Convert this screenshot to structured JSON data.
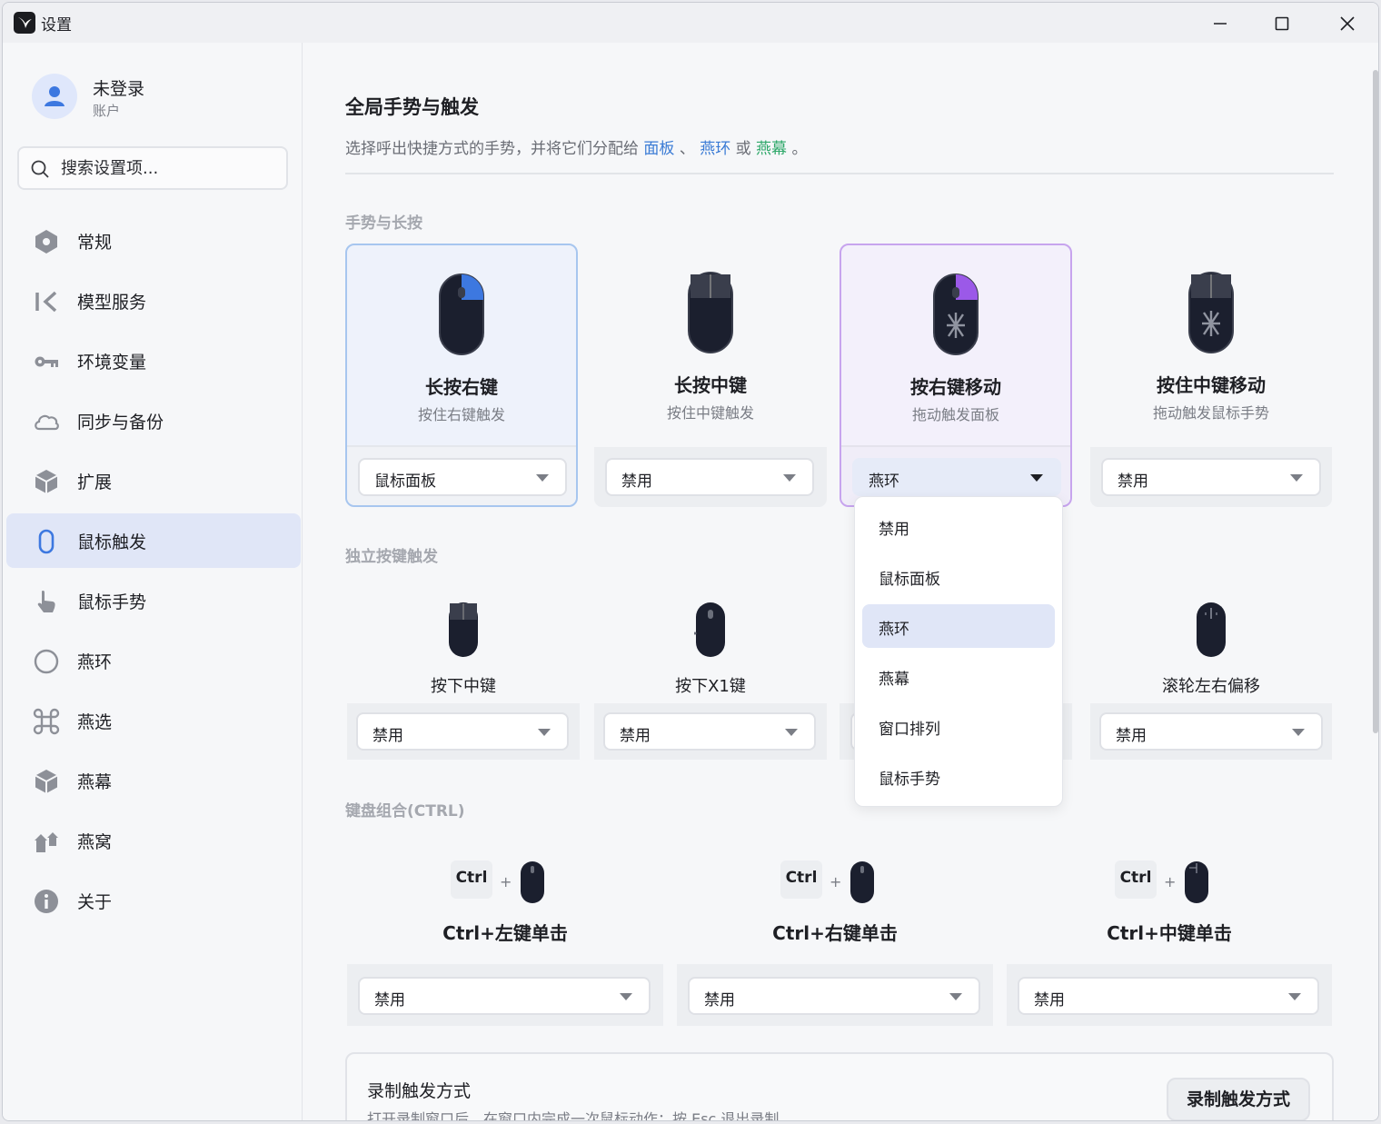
{
  "window": {
    "title": "设置"
  },
  "user": {
    "name": "未登录",
    "sub": "账户"
  },
  "search": {
    "placeholder": "搜索设置项..."
  },
  "nav": [
    {
      "label": "常规",
      "icon": "hexagon-icon"
    },
    {
      "label": "模型服务",
      "icon": "chevron-left-icon"
    },
    {
      "label": "环境变量",
      "icon": "key-icon"
    },
    {
      "label": "同步与备份",
      "icon": "cloud-icon"
    },
    {
      "label": "扩展",
      "icon": "cube-icon"
    },
    {
      "label": "鼠标触发",
      "icon": "mouse-icon"
    },
    {
      "label": "鼠标手势",
      "icon": "hand-pointer-icon"
    },
    {
      "label": "燕环",
      "icon": "circle-icon"
    },
    {
      "label": "燕选",
      "icon": "command-icon"
    },
    {
      "label": "燕幕",
      "icon": "cube-icon"
    },
    {
      "label": "燕窝",
      "icon": "houses-icon"
    },
    {
      "label": "关于",
      "icon": "info-icon"
    }
  ],
  "main": {
    "title": "全局手势与触发",
    "desc_prefix": "选择呼出快捷方式的手势，并将它们分配给",
    "link_panel": "面板",
    "sep1": "、",
    "link_ring": "燕环",
    "or": "或",
    "link_curtain": "燕幕",
    "period": "。"
  },
  "sections": {
    "gestures": "手势与长按",
    "buttons": "独立按键触发",
    "keyboard": "键盘组合(CTRL)"
  },
  "gesture_cards": [
    {
      "title": "长按右键",
      "sub": "按住右键触发",
      "value": "鼠标面板"
    },
    {
      "title": "长按中键",
      "sub": "按住中键触发",
      "value": "禁用"
    },
    {
      "title": "按右键移动",
      "sub": "拖动触发面板",
      "value": "燕环"
    },
    {
      "title": "按住中键移动",
      "sub": "拖动触发鼠标手势",
      "value": "禁用"
    }
  ],
  "button_cards": [
    {
      "title": "按下中键",
      "value": "禁用"
    },
    {
      "title": "按下X1键",
      "value": "禁用"
    },
    {
      "title": "滚轮左右偏移",
      "value": "禁用"
    }
  ],
  "keyboard_cards": [
    {
      "key": "Ctrl",
      "plus": "+",
      "title": "Ctrl+左键单击",
      "value": "禁用"
    },
    {
      "key": "Ctrl",
      "plus": "+",
      "title": "Ctrl+右键单击",
      "value": "禁用"
    },
    {
      "key": "Ctrl",
      "plus": "+",
      "title": "Ctrl+中键单击",
      "value": "禁用"
    }
  ],
  "dropdown": {
    "options": [
      "禁用",
      "鼠标面板",
      "燕环",
      "燕幕",
      "窗口排列",
      "鼠标手势"
    ],
    "selected": "燕环"
  },
  "record": {
    "title": "录制触发方式",
    "desc": "打开录制窗口后，在窗口内完成一次鼠标动作；按 Esc 退出录制。",
    "button": "录制触发方式"
  },
  "colors": {
    "accent_blue": "#3a7bd5",
    "accent_green": "#2fa86a",
    "accent_purple": "#9b59e8",
    "mouse_body": "#1b1f2e"
  }
}
